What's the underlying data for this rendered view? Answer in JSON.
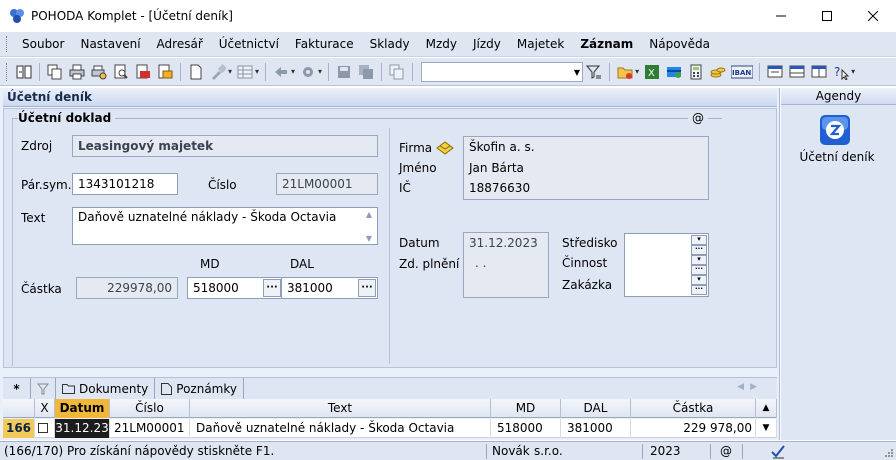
{
  "window": {
    "title": "POHODA Komplet - [Účetní deník]"
  },
  "menu": {
    "items": [
      {
        "label": "Soubor",
        "name": "menu-soubor"
      },
      {
        "label": "Nastavení",
        "name": "menu-nastaveni"
      },
      {
        "label": "Adresář",
        "name": "menu-adresar"
      },
      {
        "label": "Účetnictví",
        "name": "menu-ucetnictvi"
      },
      {
        "label": "Fakturace",
        "name": "menu-fakturace"
      },
      {
        "label": "Sklady",
        "name": "menu-sklady"
      },
      {
        "label": "Mzdy",
        "name": "menu-mzdy"
      },
      {
        "label": "Jízdy",
        "name": "menu-jizdy"
      },
      {
        "label": "Majetek",
        "name": "menu-majetek"
      },
      {
        "label": "Záznam",
        "name": "menu-zaznam"
      },
      {
        "label": "Nápověda",
        "name": "menu-napoveda"
      }
    ]
  },
  "toolbar": {
    "iban_label": "IBAN"
  },
  "main": {
    "header_title": "Účetní deník",
    "group_title": "Účetní doklad",
    "group_at": "@",
    "form": {
      "zdroj_label": "Zdroj",
      "zdroj_value": "Leasingový majetek",
      "parsym_label": "Pár.sym.",
      "parsym_value": "1343101218",
      "cislo_label": "Číslo",
      "cislo_value": "21LM00001",
      "text_label": "Text",
      "text_value": "Daňově uznatelné náklady - Škoda Octavia",
      "md_label": "MD",
      "dal_label": "DAL",
      "castka_label": "Částka",
      "castka_value": "229978,00",
      "md_value": "518000",
      "dal_value": "381000",
      "dots": "···",
      "firma_label": "Firma",
      "firma_value": "Škofin a. s.",
      "jmeno_label": "Jméno",
      "jmeno_value": "Jan Bárta",
      "ic_label": "IČ",
      "ic_value": "18876630",
      "datum_label": "Datum",
      "datum_value": "31.12.2023",
      "zdplneni_label": "Zd. plnění",
      "zdplneni_value": ". .",
      "stredisko_label": "Středisko",
      "cinnost_label": "Činnost",
      "zakazka_label": "Zakázka"
    }
  },
  "tabs": {
    "star": "*",
    "dokumenty": "Dokumenty",
    "poznamky": "Poznámky"
  },
  "table": {
    "headers": {
      "x": "X",
      "datum": "Datum",
      "cislo": "Číslo",
      "text": "Text",
      "md": "MD",
      "dal": "DAL",
      "castka": "Částka"
    },
    "rows": [
      {
        "num": "166",
        "datum": "31.12.23",
        "cislo": "21LM00001",
        "text": "Daňově uznatelné náklady - Škoda Octavia",
        "md": "518000",
        "dal": "381000",
        "castka": "229 978,00"
      }
    ]
  },
  "side": {
    "header": "Agendy",
    "item_label": "Účetní deník"
  },
  "status": {
    "help": "(166/170) Pro získání nápovědy stiskněte F1.",
    "user": "Novák",
    "company": "s.r.o.",
    "year": "2023",
    "at": "@"
  },
  "colors": {
    "accent_orange": "#f0b739",
    "panel_bg": "#dfe6f3"
  }
}
